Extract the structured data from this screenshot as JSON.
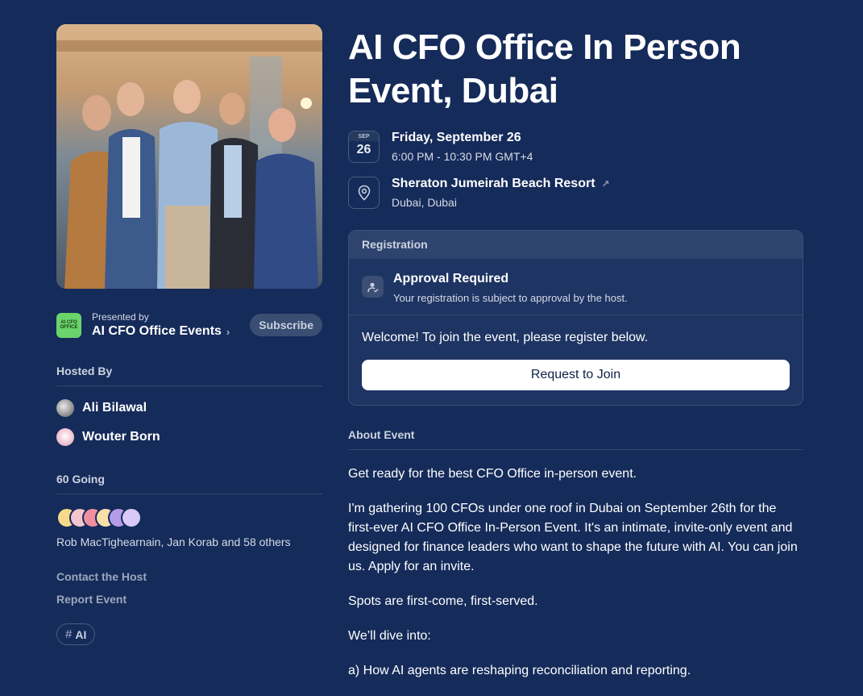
{
  "event": {
    "title": "AI CFO Office In Person Event, Dubai",
    "date": {
      "month": "SEP",
      "day": "26",
      "weekday_date": "Friday, September 26",
      "time": "6:00 PM - 10:30 PM GMT+4"
    },
    "location": {
      "venue": "Sheraton Jumeirah Beach Resort",
      "external_icon": "arrow-up-right-icon",
      "city": "Dubai, Dubai"
    }
  },
  "presenter": {
    "presented_by": "Presented by",
    "name": "AI CFO Office Events",
    "logo_text": "AI CFO OFFICE",
    "logo_color": "#6bd46a",
    "subscribe_label": "Subscribe"
  },
  "hosts": {
    "heading": "Hosted By",
    "items": [
      {
        "name": "Ali Bilawal"
      },
      {
        "name": "Wouter Born"
      }
    ]
  },
  "going": {
    "heading": "60 Going",
    "names": "Rob MacTighearnain, Jan Korab and 58 others"
  },
  "links": {
    "contact": "Contact the Host",
    "report": "Report Event"
  },
  "tags": [
    {
      "hash": "#",
      "label": "AI"
    }
  ],
  "registration": {
    "heading": "Registration",
    "approval_title": "Approval Required",
    "approval_sub": "Your registration is subject to approval by the host.",
    "welcome": "Welcome! To join the event, please register below.",
    "button_label": "Request to Join"
  },
  "about": {
    "heading": "About Event",
    "paragraphs": [
      "Get ready for the best CFO Office in-person event.",
      "I'm gathering 100 CFOs under one roof in Dubai on September 26th for the first-ever AI CFO Office In-Person Event. It's an intimate, invite-only event and designed for finance leaders who want to shape the future with AI. You can join us. Apply for an invite.",
      "Spots are first-come, first-served.",
      "We’ll dive into:",
      "a) How AI agents are reshaping reconciliation and reporting."
    ]
  },
  "colors": {
    "background": "#152b5a",
    "card": "#1e3463",
    "button": "#ffffff"
  }
}
